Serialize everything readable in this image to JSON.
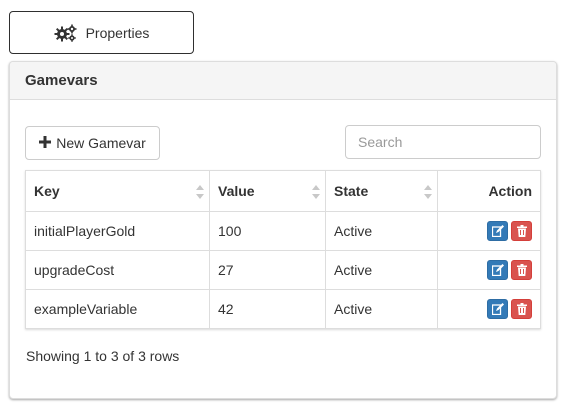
{
  "toolbar": {
    "properties_label": "Properties",
    "properties_icon": "gears-icon"
  },
  "panel": {
    "title": "Gamevars",
    "new_button_label": "New Gamevar",
    "new_button_icon": "plus-icon",
    "search_placeholder": "Search",
    "search_value": ""
  },
  "table": {
    "columns": [
      "Key",
      "Value",
      "State",
      "Action"
    ],
    "rows": [
      {
        "key": "initialPlayerGold",
        "value": "100",
        "state": "Active"
      },
      {
        "key": "upgradeCost",
        "value": "27",
        "state": "Active"
      },
      {
        "key": "exampleVariable",
        "value": "42",
        "state": "Active"
      }
    ],
    "footer": "Showing 1 to 3 of 3 rows"
  },
  "colors": {
    "edit_button": "#337ab7",
    "delete_button": "#d9534f",
    "panel_heading_bg": "#f5f5f5"
  }
}
